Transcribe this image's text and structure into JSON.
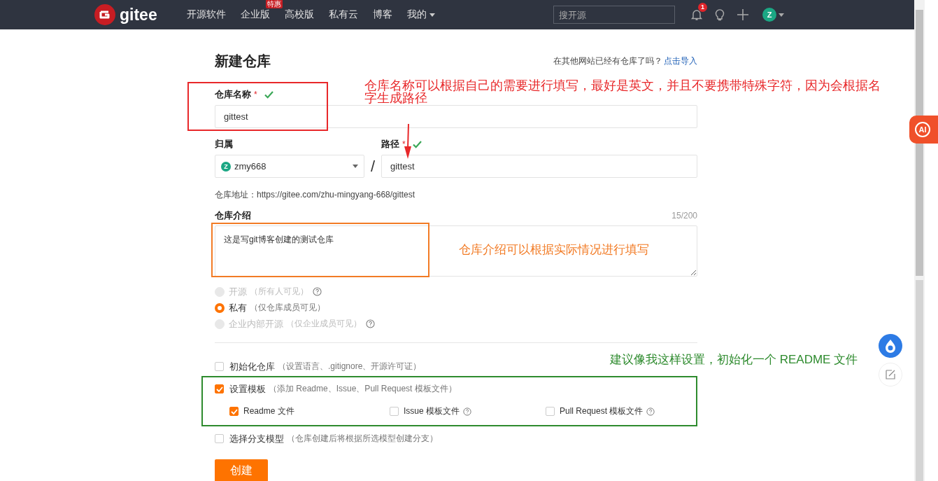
{
  "nav": {
    "logo": "gitee",
    "items": [
      {
        "label": "开源软件"
      },
      {
        "label": "企业版",
        "badge": "特惠"
      },
      {
        "label": "高校版"
      },
      {
        "label": "私有云"
      },
      {
        "label": "博客"
      },
      {
        "label": "我的",
        "dropdown": true
      }
    ],
    "search": {
      "placeholder": "搜开源"
    },
    "notification_count": "1",
    "avatar": "Z"
  },
  "form": {
    "title": "新建仓库",
    "import_prompt": "在其他网站已经有仓库了吗？",
    "import_link": "点击导入",
    "name": {
      "label": "仓库名称",
      "required": "*",
      "valid": true,
      "value": "gittest"
    },
    "owner": {
      "label": "归属",
      "avatar": "Z",
      "value": "zmy668"
    },
    "separator": "/",
    "path": {
      "label": "路径",
      "required": "*",
      "valid": true,
      "value": "gittest"
    },
    "address": "仓库地址：https://gitee.com/zhu-mingyang-668/gittest",
    "intro": {
      "label": "仓库介绍",
      "counter": "15/200",
      "value": "这是写git博客创建的测试仓库"
    },
    "visibility": [
      {
        "label": "开源",
        "hint": "（所有人可见）",
        "help": true,
        "selected": false,
        "disabled": true
      },
      {
        "label": "私有",
        "hint": "（仅仓库成员可见）",
        "help": false,
        "selected": true,
        "disabled": false
      },
      {
        "label": "企业内部开源",
        "hint": "（仅企业成员可见）",
        "help": true,
        "selected": false,
        "disabled": true
      }
    ],
    "options": [
      {
        "label": "初始化仓库",
        "hint": "（设置语言、.gitignore、开源许可证）",
        "checked": false
      },
      {
        "label": "设置模板",
        "hint": "（添加 Readme、Issue、Pull Request 模板文件）",
        "checked": true,
        "children": [
          {
            "label": "Readme 文件",
            "checked": true,
            "help": false
          },
          {
            "label": "Issue 模板文件",
            "checked": false,
            "help": true
          },
          {
            "label": "Pull Request 模板文件",
            "checked": false,
            "help": true
          }
        ]
      },
      {
        "label": "选择分支模型",
        "hint": "（仓库创建后将根据所选模型创建分支）",
        "checked": false
      }
    ],
    "submit": "创建"
  },
  "annotations": {
    "name_note": "仓库名称可以根据自己的需要进行填写，最好是英文，并且不要携带特殊字符，因为会根据名字生成路径",
    "intro_note": "仓库介绍可以根据实际情况进行填写",
    "template_note": "建议像我这样设置，初始化一个 README 文件"
  },
  "floating": {
    "ai_label": "AI"
  }
}
